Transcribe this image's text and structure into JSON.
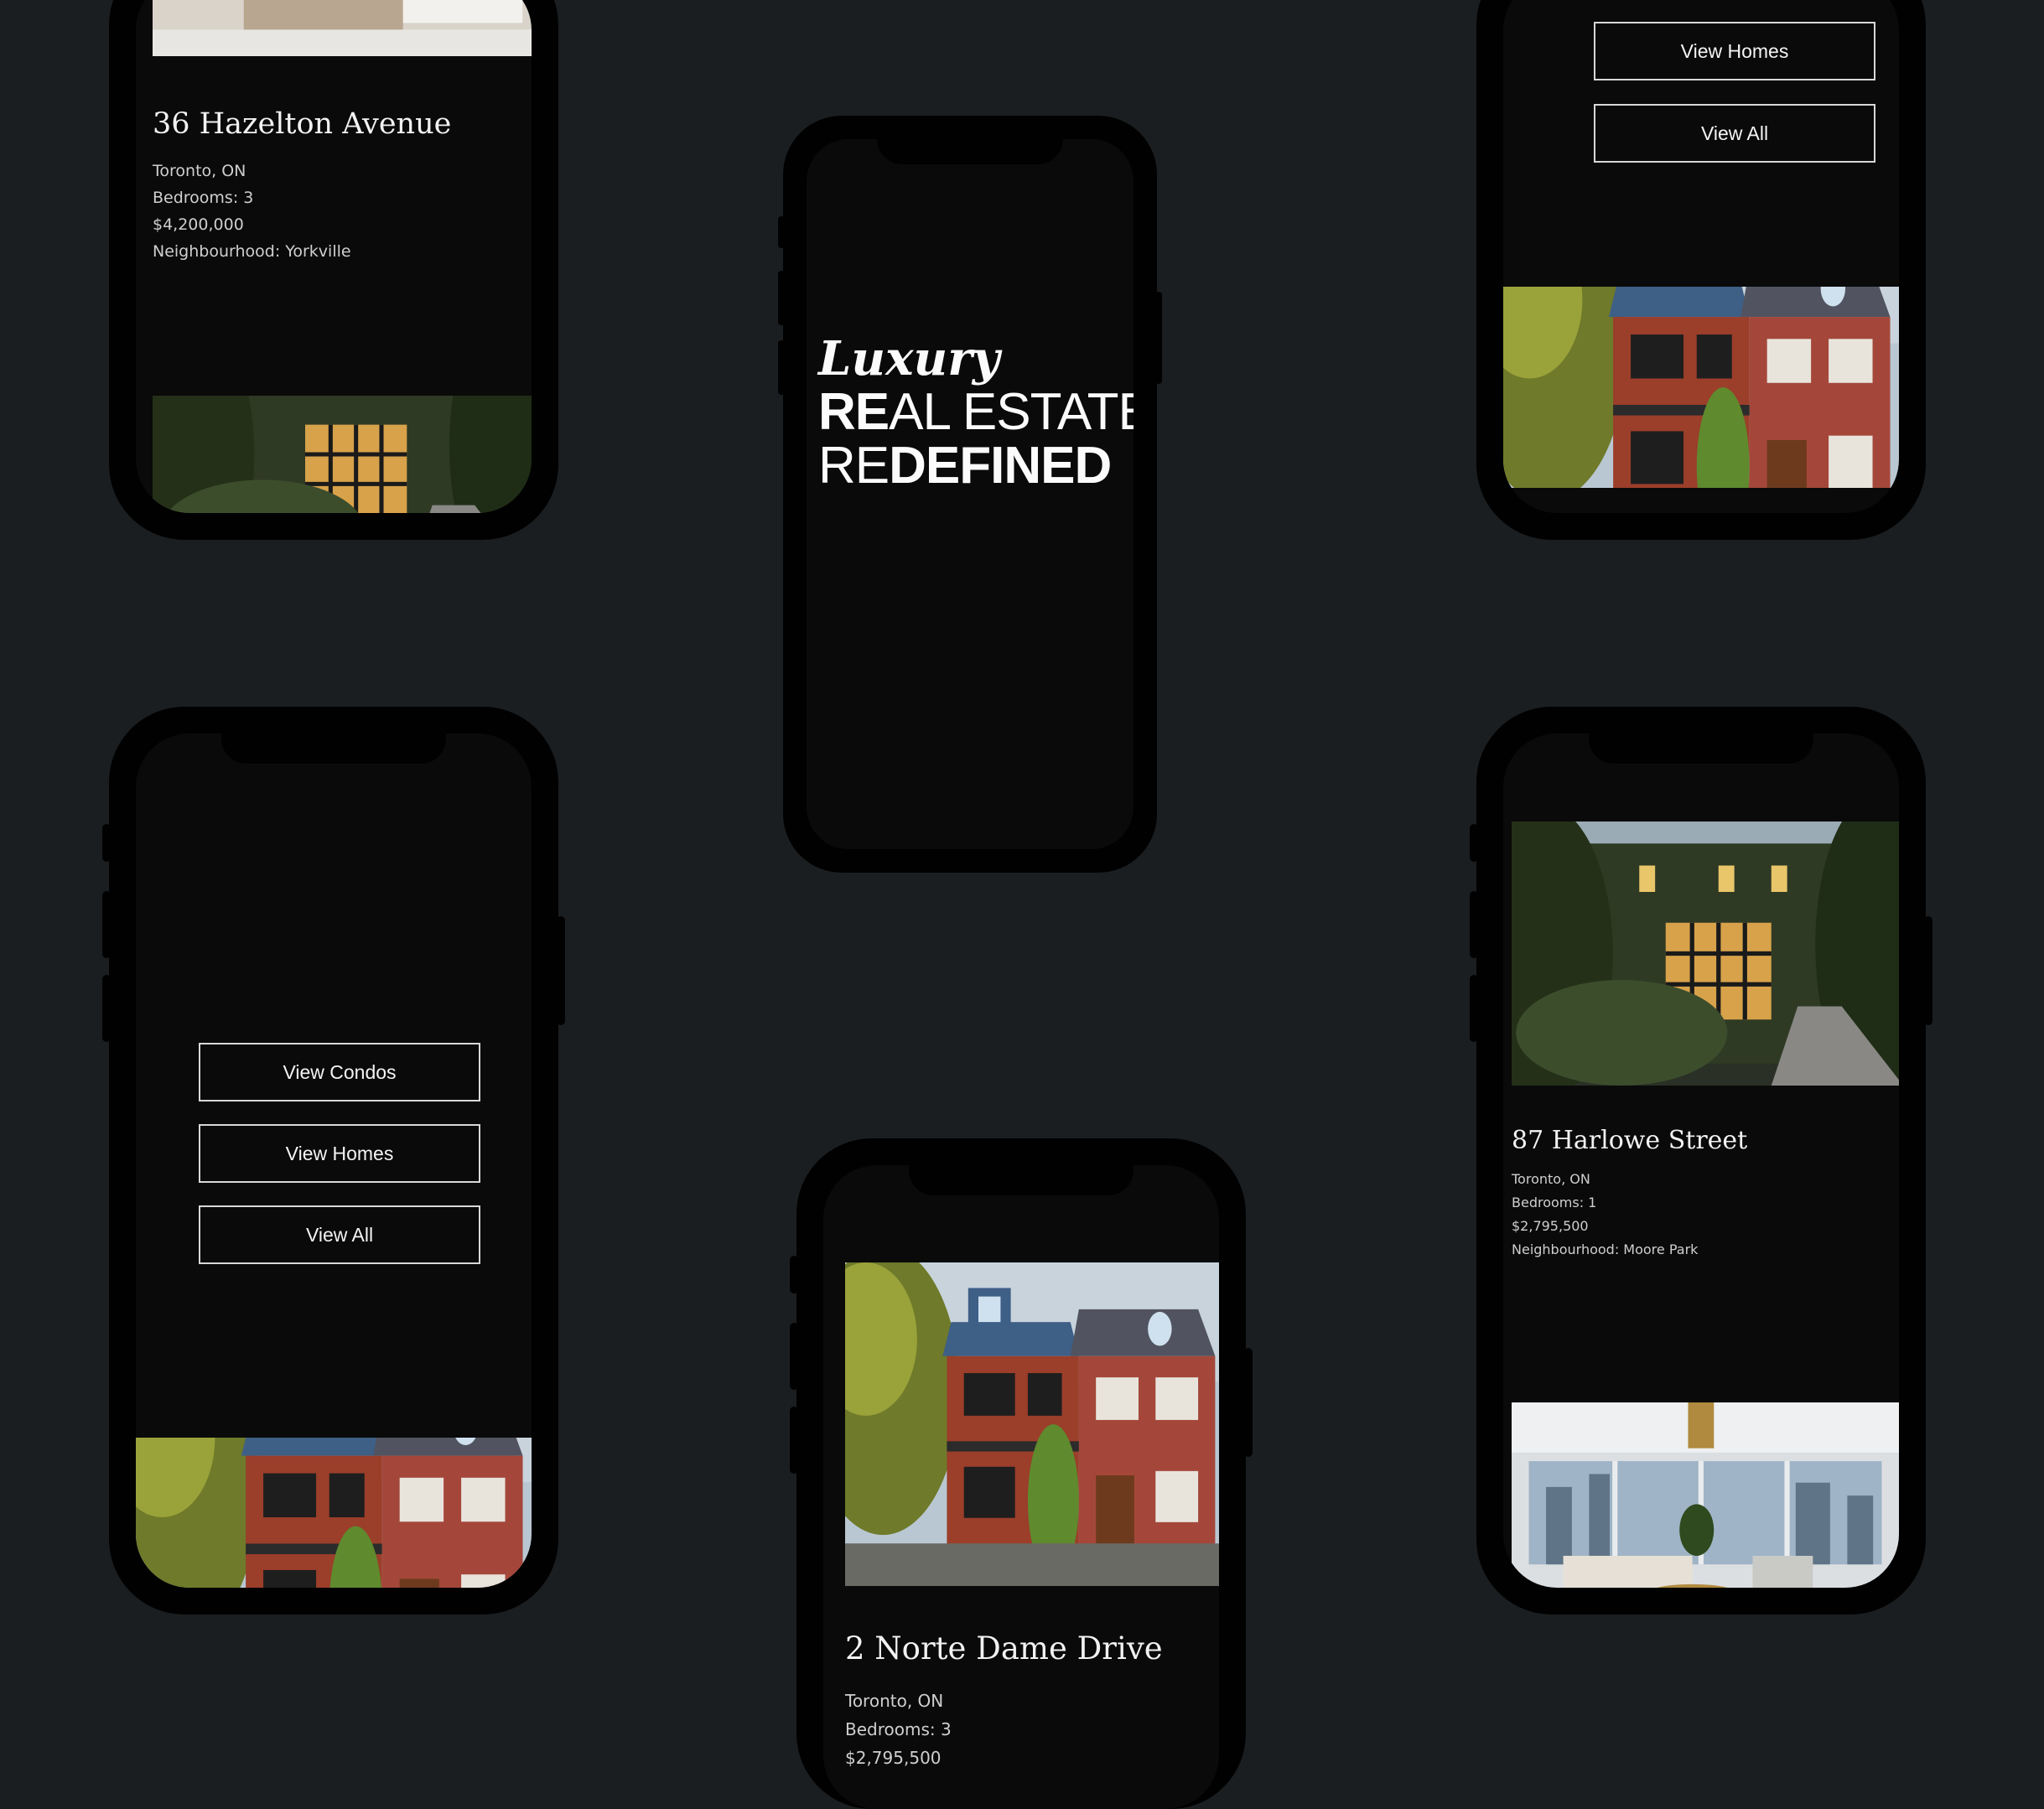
{
  "hero": {
    "line1": "Luxury",
    "line2_bold": "RE",
    "line2_thin": "AL ESTATE",
    "line3_thin": "RE",
    "line3_bold": "DEFINED"
  },
  "listings": [
    {
      "address": "36 Hazelton Avenue",
      "city": "Toronto, ON",
      "bedrooms": "Bedrooms: 3",
      "price": "$4,200,000",
      "neighbourhood": "Neighbourhood: Yorkville"
    },
    {
      "address": "87 Harlowe Street",
      "city": "Toronto, ON",
      "bedrooms": "Bedrooms: 1",
      "price": "$2,795,500",
      "neighbourhood": "Neighbourhood: Moore Park"
    },
    {
      "address": "2 Norte Dame Drive",
      "city": "Toronto, ON",
      "bedrooms": "Bedrooms: 3",
      "price": "$2,795,500"
    }
  ],
  "menu_buttons": {
    "view_condos": "View Condos",
    "view_homes": "View Homes",
    "view_all": "View All"
  },
  "colors": {
    "background": "#1b1e20",
    "phone_body": "#010101",
    "screen": "#0a0a0a",
    "text": "#f2f2f2"
  }
}
